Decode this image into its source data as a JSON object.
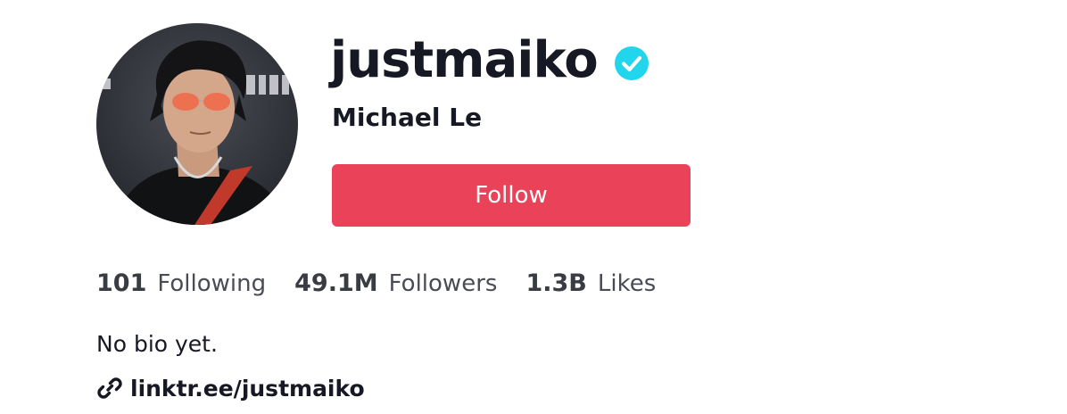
{
  "profile": {
    "username": "justmaiko",
    "display_name": "Michael Le",
    "verified_icon": "verified-badge-icon",
    "follow_label": "Follow",
    "bio": "No bio yet.",
    "link": "linktr.ee/justmaiko",
    "link_icon": "link-icon"
  },
  "stats": {
    "following": {
      "value": "101",
      "label": "Following"
    },
    "followers": {
      "value": "49.1M",
      "label": "Followers"
    },
    "likes": {
      "value": "1.3B",
      "label": "Likes"
    }
  },
  "colors": {
    "follow_button": "#ea4359",
    "verified_badge": "#20d5ec",
    "text_primary": "#161823",
    "text_secondary": "#4a4c55"
  }
}
